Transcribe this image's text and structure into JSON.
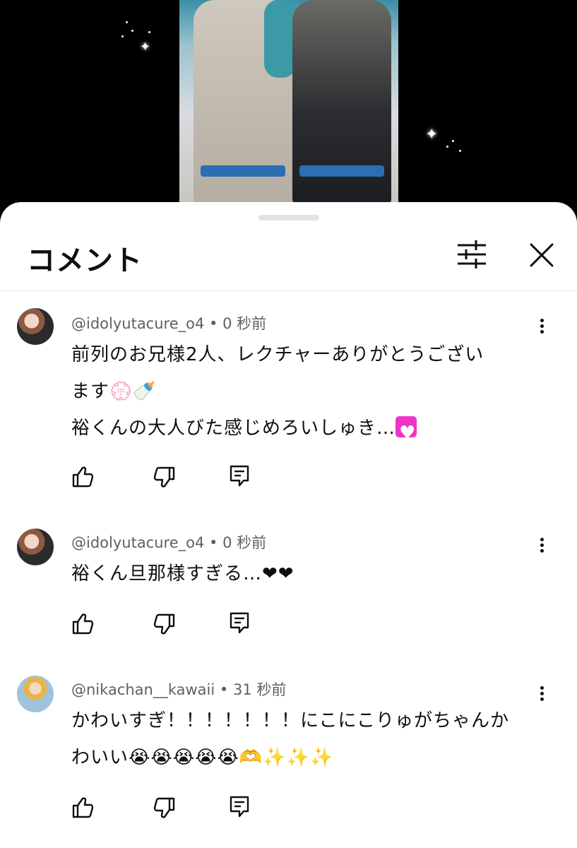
{
  "sheet": {
    "title": "コメント"
  },
  "comments": [
    {
      "author": "@idolyutacure_o4",
      "separator": "•",
      "time": "0 秒前",
      "line1": "前列のお兄様2人、レクチャーありがとうござい",
      "line2": "ます💮🍼",
      "line3": "裕くんの大人びた感じめろいしゅき…"
    },
    {
      "author": "@idolyutacure_o4",
      "separator": "•",
      "time": "0 秒前",
      "line1": "裕くん旦那様すぎる…❤❤"
    },
    {
      "author": "@nikachan__kawaii",
      "separator": "•",
      "time": "31 秒前",
      "line1": "かわいすぎ！！！！！！！にこにこりゅがちゃんか",
      "line2": "わいい😭😭😭😭😭🫶✨✨✨"
    }
  ],
  "icons": {
    "filter": "tune-icon",
    "close": "close-icon",
    "more": "more-vert-icon",
    "like": "thumb-up-icon",
    "dislike": "thumb-down-icon",
    "reply": "reply-icon"
  },
  "colors": {
    "text": "#0f0f0f",
    "meta": "#606060",
    "pink_heart": "#f033c7"
  }
}
